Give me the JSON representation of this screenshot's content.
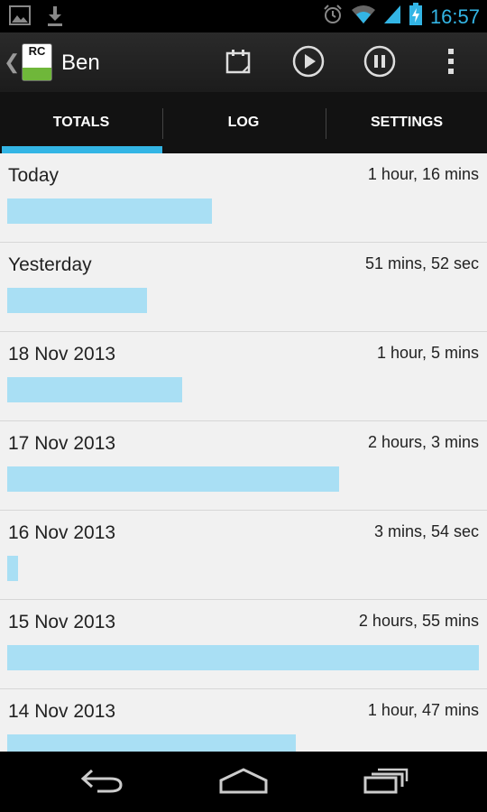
{
  "status_bar": {
    "time": "16:57",
    "icons": [
      "image-icon",
      "download-icon",
      "alarm-icon",
      "wifi-icon",
      "signal-icon",
      "battery-charging-icon"
    ]
  },
  "action_bar": {
    "title": "Ben",
    "actions": [
      "calendar-icon",
      "play-icon",
      "pause-icon",
      "overflow-menu-icon"
    ]
  },
  "tabs": [
    {
      "label": "TOTALS",
      "selected": true
    },
    {
      "label": "LOG",
      "selected": false
    },
    {
      "label": "SETTINGS",
      "selected": false
    }
  ],
  "accent_color": "#33b5e5",
  "bar_color": "#a9dff4",
  "chart_data": {
    "type": "bar",
    "categories": [
      "Today",
      "Yesterday",
      "18 Nov 2013",
      "17 Nov 2013",
      "16 Nov 2013",
      "15 Nov 2013",
      "14 Nov 2013"
    ],
    "labels": [
      "1 hour, 16 mins",
      "51 mins, 52 sec",
      "1 hour, 5 mins",
      "2 hours, 3 mins",
      "3 mins, 54 sec",
      "2 hours, 55 mins",
      "1 hour, 47 mins"
    ],
    "values_minutes": [
      76,
      51.9,
      65,
      123,
      3.9,
      175,
      107
    ],
    "max_minutes": 175
  },
  "nav_bar": [
    "back-icon",
    "home-icon",
    "recent-apps-icon"
  ]
}
